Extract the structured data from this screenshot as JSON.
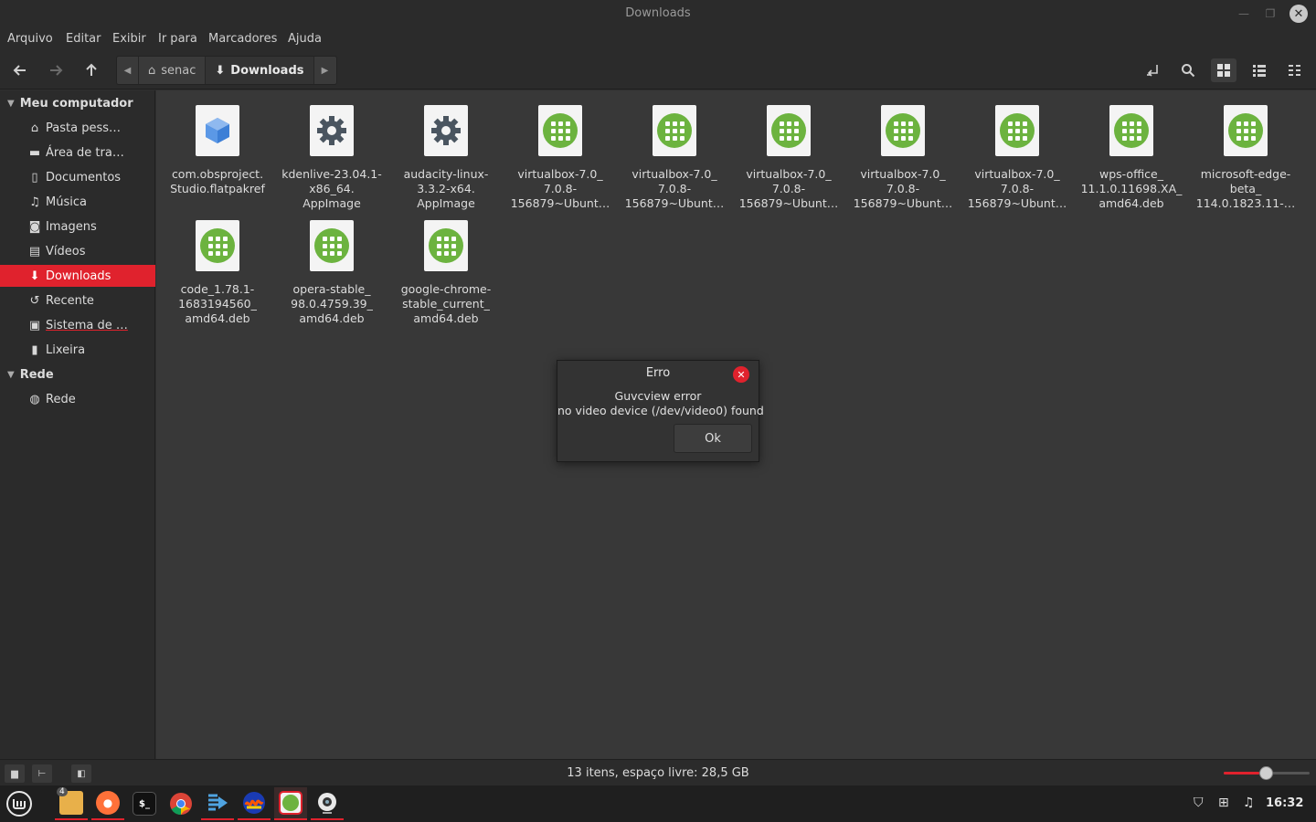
{
  "window": {
    "title": "Downloads",
    "minimize_icon": "minimize-icon",
    "maximize_icon": "maximize-icon",
    "close_icon": "close-icon"
  },
  "menu": {
    "items": [
      "Arquivo",
      "Editar",
      "Exibir",
      "Ir para",
      "Marcadores",
      "Ajuda"
    ]
  },
  "toolbar": {
    "breadcrumb": [
      "senac",
      "Downloads"
    ]
  },
  "sidebar": {
    "section_computer": "Meu computador",
    "items": [
      {
        "label": "Pasta pess…",
        "icon": "home-icon"
      },
      {
        "label": "Área de tra…",
        "icon": "desktop-icon"
      },
      {
        "label": "Documentos",
        "icon": "document-icon"
      },
      {
        "label": "Música",
        "icon": "music-icon"
      },
      {
        "label": "Imagens",
        "icon": "camera-icon"
      },
      {
        "label": "Vídeos",
        "icon": "film-icon"
      },
      {
        "label": "Downloads",
        "icon": "download-icon"
      },
      {
        "label": "Recente",
        "icon": "history-icon"
      },
      {
        "label": "Sistema de …",
        "icon": "drive-icon"
      },
      {
        "label": "Lixeira",
        "icon": "trash-icon"
      }
    ],
    "section_network": "Rede",
    "network_items": [
      {
        "label": "Rede",
        "icon": "globe-icon"
      }
    ]
  },
  "files": [
    {
      "name_lines": [
        "com.obsproject.",
        "Studio.flatpakref"
      ],
      "icon": "package-icon"
    },
    {
      "name_lines": [
        "kdenlive-23.04.1-",
        "x86_64.",
        "AppImage"
      ],
      "icon": "gear-icon"
    },
    {
      "name_lines": [
        "audacity-linux-",
        "3.3.2-x64.",
        "AppImage"
      ],
      "icon": "gear-icon"
    },
    {
      "name_lines": [
        "virtualbox-7.0_",
        "7.0.8-",
        "156879~Ubunt…"
      ],
      "icon": "deb-icon"
    },
    {
      "name_lines": [
        "virtualbox-7.0_",
        "7.0.8-",
        "156879~Ubunt…"
      ],
      "icon": "deb-icon"
    },
    {
      "name_lines": [
        "virtualbox-7.0_",
        "7.0.8-",
        "156879~Ubunt…"
      ],
      "icon": "deb-icon"
    },
    {
      "name_lines": [
        "virtualbox-7.0_",
        "7.0.8-",
        "156879~Ubunt…"
      ],
      "icon": "deb-icon"
    },
    {
      "name_lines": [
        "virtualbox-7.0_",
        "7.0.8-",
        "156879~Ubunt…"
      ],
      "icon": "deb-icon"
    },
    {
      "name_lines": [
        "wps-office_",
        "11.1.0.11698.XA_",
        "amd64.deb"
      ],
      "icon": "deb-icon"
    },
    {
      "name_lines": [
        "microsoft-edge-",
        "beta_",
        "114.0.1823.11-…"
      ],
      "icon": "deb-icon"
    },
    {
      "name_lines": [
        "code_1.78.1-",
        "1683194560_",
        "amd64.deb"
      ],
      "icon": "deb-icon"
    },
    {
      "name_lines": [
        "opera-stable_",
        "98.0.4759.39_",
        "amd64.deb"
      ],
      "icon": "deb-icon"
    },
    {
      "name_lines": [
        "google-chrome-",
        "stable_current_",
        "amd64.deb"
      ],
      "icon": "deb-icon"
    }
  ],
  "dialog": {
    "title": "Erro",
    "message_line1": "Guvcview error",
    "message_line2": "no video device (/dev/video0) found",
    "ok_label": "Ok"
  },
  "status": {
    "text": "13 itens, espaço livre: 28,5 GB",
    "zoom_fraction": 0.5
  },
  "taskbar": {
    "badge_count": "4",
    "clock": "16:32",
    "launchers": [
      "menu-icon",
      "files-icon",
      "firefox-icon",
      "terminal-icon",
      "chrome-icon",
      "kdenlive-icon",
      "audacity-icon",
      "package-installer-icon",
      "guvcview-icon"
    ]
  },
  "colors": {
    "accent": "#e0222d",
    "deb_green": "#6cb33f"
  }
}
